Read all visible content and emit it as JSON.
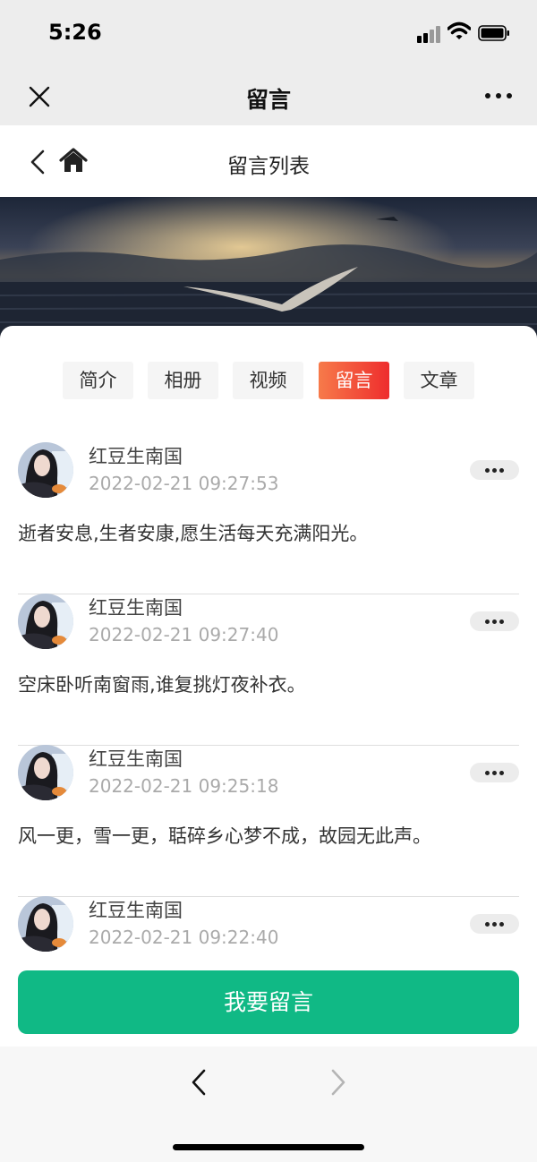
{
  "status": {
    "time": "5:26"
  },
  "wx_nav": {
    "title": "留言"
  },
  "header": {
    "title": "留言列表"
  },
  "tabs": [
    {
      "label": "简介",
      "active": false
    },
    {
      "label": "相册",
      "active": false
    },
    {
      "label": "视频",
      "active": false
    },
    {
      "label": "留言",
      "active": true
    },
    {
      "label": "文章",
      "active": false
    }
  ],
  "messages": [
    {
      "name": "红豆生南国",
      "time": "2022-02-21 09:27:53",
      "text": "逝者安息,生者安康,愿生活每天充满阳光。"
    },
    {
      "name": "红豆生南国",
      "time": "2022-02-21 09:27:40",
      "text": "空床卧听南窗雨,谁复挑灯夜补衣。"
    },
    {
      "name": "红豆生南国",
      "time": "2022-02-21 09:25:18",
      "text": "风一更，雪一更，聒碎乡心梦不成，故园无此声。"
    },
    {
      "name": "红豆生南国",
      "time": "2022-02-21 09:22:40",
      "text": ""
    }
  ],
  "leave_button": {
    "label": "我要留言"
  },
  "colors": {
    "accent_green": "#10b985",
    "active_tab_start": "#f77a4a",
    "active_tab_end": "#ee2d2d"
  },
  "icons": [
    "close-icon",
    "more-icon",
    "back-icon",
    "home-icon",
    "chevron-left-icon",
    "chevron-right-icon"
  ]
}
